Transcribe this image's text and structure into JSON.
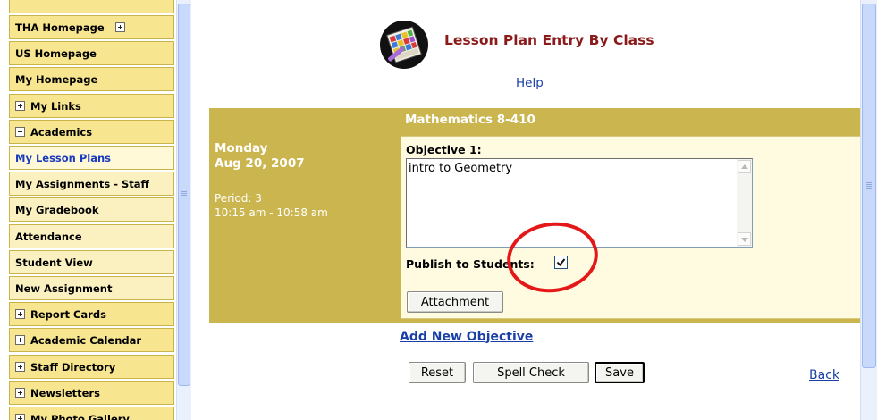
{
  "sidebar": {
    "items": [
      {
        "label": "THA Homepage",
        "expander": "plus-after",
        "style": "main"
      },
      {
        "label": "US Homepage",
        "expander": "none",
        "style": "main"
      },
      {
        "label": "My Homepage",
        "expander": "none",
        "style": "main"
      },
      {
        "label": "My Links",
        "expander": "plus",
        "style": "main"
      },
      {
        "label": "Academics",
        "expander": "minus",
        "style": "main"
      },
      {
        "label": "My Lesson Plans",
        "expander": "none",
        "style": "active"
      },
      {
        "label": "My Assignments - Staff",
        "expander": "none",
        "style": "sub"
      },
      {
        "label": "My Gradebook",
        "expander": "none",
        "style": "sub"
      },
      {
        "label": "Attendance",
        "expander": "none",
        "style": "sub"
      },
      {
        "label": "Student View",
        "expander": "none",
        "style": "sub"
      },
      {
        "label": "New Assignment",
        "expander": "none",
        "style": "sub"
      },
      {
        "label": "Report Cards",
        "expander": "plus",
        "style": "main"
      },
      {
        "label": "Academic Calendar",
        "expander": "plus",
        "style": "main"
      },
      {
        "label": "Staff Directory",
        "expander": "plus",
        "style": "main"
      },
      {
        "label": "Newsletters",
        "expander": "plus",
        "style": "main"
      },
      {
        "label": "My Photo Gallery",
        "expander": "plus",
        "style": "main"
      }
    ]
  },
  "header": {
    "title": "Lesson Plan Entry By Class",
    "help_link": "Help",
    "logo_icon": "lesson-plan-notebook-icon"
  },
  "lesson": {
    "class_name": "Mathematics 8-410",
    "day": "Monday",
    "date": "Aug 20, 2007",
    "period": "Period: 3",
    "time": "10:15 am - 10:58 am",
    "objective_label": "Objective 1:",
    "objective_text": "intro to Geometry",
    "publish_label": "Publish to Students:",
    "publish_checked": true,
    "attachment_button": "Attachment",
    "add_objective_link": "Add New Objective"
  },
  "actions": {
    "reset": "Reset",
    "spell_check": "Spell Check",
    "save": "Save",
    "back": "Back"
  },
  "colors": {
    "sidebar_main": "#f7e58f",
    "sidebar_sub": "#fbf1c0",
    "table_header": "#cbb54e",
    "content_bg": "#fffbe0",
    "title_red": "#8b1a1a",
    "link_blue": "#1a3fa6",
    "annotation_circle": "#e41818"
  }
}
